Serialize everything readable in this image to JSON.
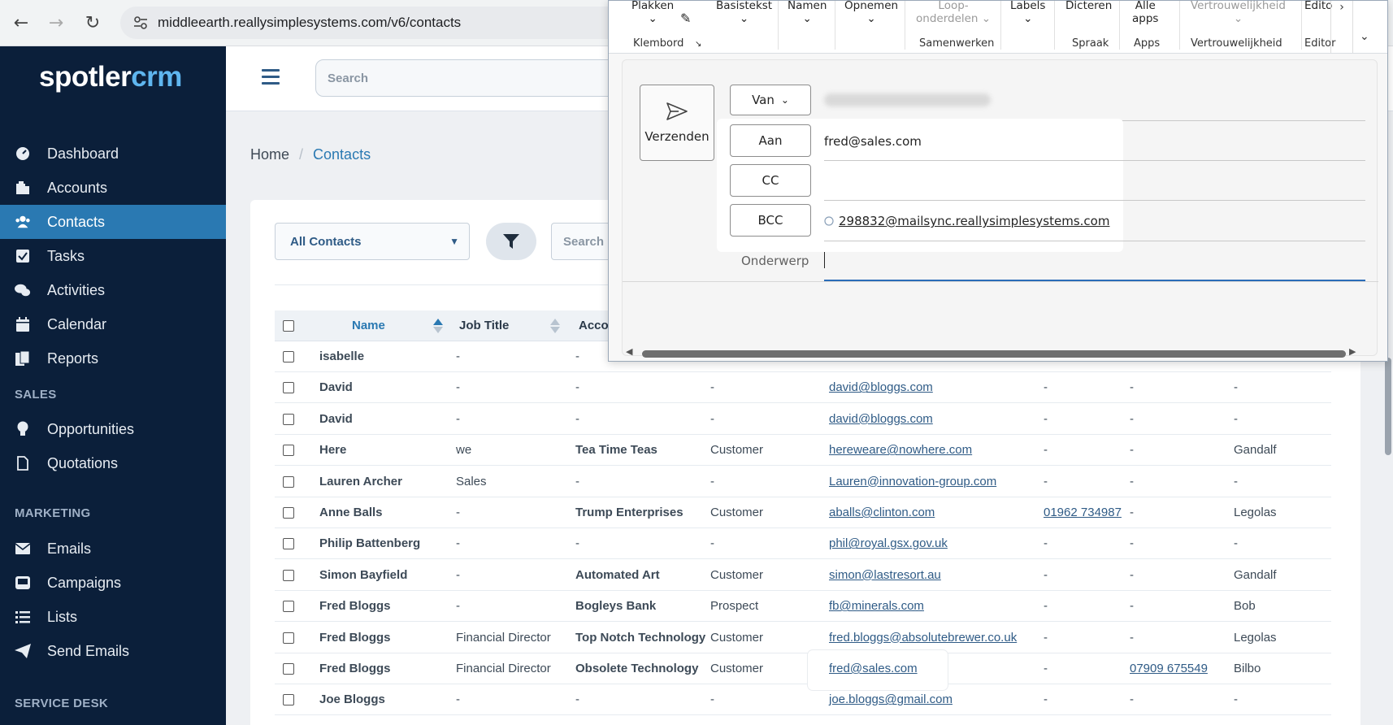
{
  "browser": {
    "url": "middleearth.reallysimplesystems.com/v6/contacts"
  },
  "sidebar": {
    "logo_part1": "spotler",
    "logo_part2": "crm",
    "items": [
      {
        "label": "Dashboard",
        "icon": "dashboard-icon"
      },
      {
        "label": "Accounts",
        "icon": "accounts-icon"
      },
      {
        "label": "Contacts",
        "icon": "contacts-icon",
        "active": true
      },
      {
        "label": "Tasks",
        "icon": "tasks-icon"
      },
      {
        "label": "Activities",
        "icon": "activities-icon"
      },
      {
        "label": "Calendar",
        "icon": "calendar-icon"
      },
      {
        "label": "Reports",
        "icon": "reports-icon"
      }
    ],
    "sales_label": "SALES",
    "sales_items": [
      {
        "label": "Opportunities",
        "icon": "lightbulb-icon"
      },
      {
        "label": "Quotations",
        "icon": "document-icon"
      }
    ],
    "marketing_label": "MARKETING",
    "marketing_items": [
      {
        "label": "Emails",
        "icon": "envelope-icon"
      },
      {
        "label": "Campaigns",
        "icon": "campaign-icon"
      },
      {
        "label": "Lists",
        "icon": "list-icon"
      },
      {
        "label": "Send Emails",
        "icon": "paper-plane-icon"
      }
    ],
    "service_label": "SERVICE DESK"
  },
  "header": {
    "search_placeholder": "Search"
  },
  "breadcrumb": {
    "home": "Home",
    "separator": "/",
    "current": "Contacts"
  },
  "toolbar": {
    "view_select": "All Contacts",
    "search_placeholder": "Search"
  },
  "table": {
    "headers": {
      "name": "Name",
      "job_title": "Job Title",
      "account": "Acco"
    },
    "rows": [
      [
        "isabelle",
        "-",
        "-",
        "",
        "",
        "",
        "",
        ""
      ],
      [
        "David",
        "-",
        "-",
        "-",
        "david@bloggs.com",
        "-",
        "-",
        "-"
      ],
      [
        "David",
        "-",
        "-",
        "-",
        "david@bloggs.com",
        "-",
        "-",
        "-"
      ],
      [
        "Here",
        "we",
        "Tea Time Teas",
        "Customer",
        "hereweare@nowhere.com",
        "-",
        "-",
        "Gandalf"
      ],
      [
        "Lauren Archer",
        "Sales",
        "-",
        "-",
        "Lauren@innovation-group.com",
        "-",
        "-",
        "-"
      ],
      [
        "Anne Balls",
        "-",
        "Trump Enterprises",
        "Customer",
        "aballs@clinton.com",
        "01962 734987",
        "-",
        "Legolas"
      ],
      [
        "Philip Battenberg",
        "-",
        "-",
        "-",
        "phil@royal.gsx.gov.uk",
        "-",
        "-",
        "-"
      ],
      [
        "Simon Bayfield",
        "-",
        "Automated Art",
        "Customer",
        "simon@lastresort.au",
        "-",
        "-",
        "Gandalf"
      ],
      [
        "Fred Bloggs",
        "-",
        "Bogleys Bank",
        "Prospect",
        "fb@minerals.com",
        "-",
        "-",
        "Bob"
      ],
      [
        "Fred Bloggs",
        "Financial Director",
        "Top Notch Technology",
        "Customer",
        "fred.bloggs@absolutebrewer.co.uk",
        "-",
        "-",
        "Legolas"
      ],
      [
        "Fred Bloggs",
        "Financial Director",
        "Obsolete Technology",
        "Customer",
        "fred@sales.com",
        "-",
        "07909 675549",
        "Bilbo"
      ],
      [
        "Joe Bloggs",
        "-",
        "-",
        "-",
        "joe.bloggs@gmail.com",
        "-",
        "-",
        "-"
      ]
    ]
  },
  "compose": {
    "ribbon": {
      "plakken": "Plakken",
      "basistekst": "Basistekst",
      "namen": "Namen",
      "opnemen": "Opnemen",
      "loop1": "Loop-",
      "loop2": "onderdelen",
      "labels": "Labels",
      "dicteren": "Dicteren",
      "alle": "Alle",
      "apps": "apps",
      "vertrouwelijkheid_btn": "Vertrouwelijkheid",
      "editor_btn": "Edito",
      "group_klembord": "Klembord",
      "group_samenwerken": "Samenwerken",
      "group_spraak": "Spraak",
      "group_apps": "Apps",
      "group_vertrouwelijkheid": "Vertrouwelijkheid",
      "group_editor": "Editor"
    },
    "send_label": "Verzenden",
    "from_label": "Van",
    "to_label": "Aan",
    "to_value": "fred@sales.com",
    "cc_label": "CC",
    "bcc_label": "BCC",
    "bcc_value": "298832@mailsync.reallysimplesystems.com",
    "subject_label": "Onderwerp"
  }
}
